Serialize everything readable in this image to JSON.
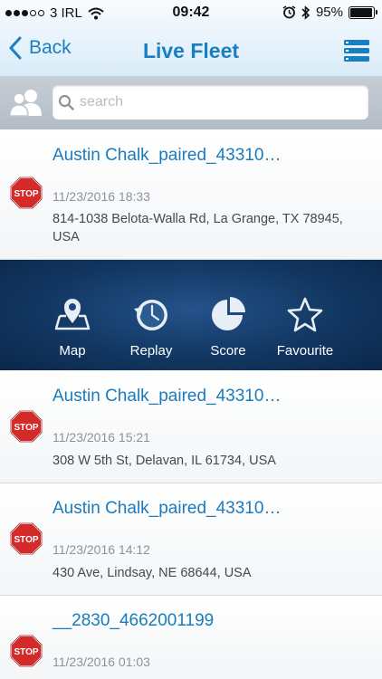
{
  "status_bar": {
    "carrier": "3 IRL",
    "time": "09:42",
    "battery_text": "95%",
    "battery_level": 0.95
  },
  "nav": {
    "back_label": "Back",
    "title": "Live Fleet"
  },
  "search": {
    "placeholder": "search"
  },
  "actions": {
    "map": "Map",
    "replay": "Replay",
    "score": "Score",
    "favourite": "Favourite"
  },
  "vehicles": [
    {
      "name": "Austin Chalk_paired_43310…",
      "timestamp": "11/23/2016 18:33",
      "address": "814-1038 Belota-Walla Rd, La Grange, TX 78945, USA",
      "status_icon": "stop-sign-icon"
    },
    {
      "name": "Austin Chalk_paired_43310…",
      "timestamp": "11/23/2016 15:21",
      "address": "308 W 5th St, Delavan, IL 61734, USA",
      "status_icon": "stop-sign-icon"
    },
    {
      "name": "Austin Chalk_paired_43310…",
      "timestamp": "11/23/2016 14:12",
      "address": "430 Ave, Lindsay, NE 68644, USA",
      "status_icon": "stop-sign-icon"
    },
    {
      "name": "__2830_4662001199",
      "timestamp": "11/23/2016 01:03",
      "address": "",
      "status_icon": "stop-sign-icon"
    }
  ],
  "stop_sign_text": "STOP",
  "colors": {
    "accent": "#1a7fc2",
    "stop_red": "#d42a2a",
    "action_bar": "#123762"
  }
}
